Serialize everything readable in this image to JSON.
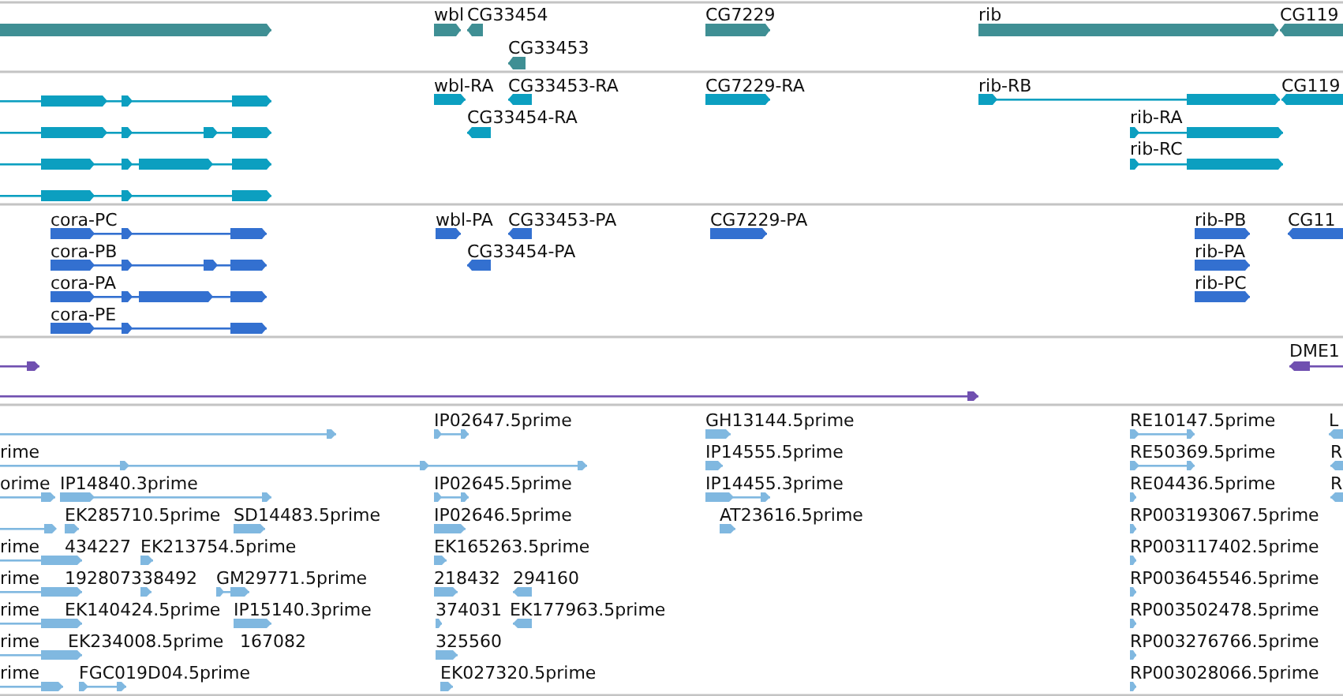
{
  "tracks": [
    {
      "kind": "gene",
      "color": "#3f8f94",
      "features": [
        {
          "reverse": false
        },
        {
          "label": "wbl",
          "reverse": false
        },
        {
          "label": "CG33454",
          "reverse": true
        },
        {
          "label": "CG33453",
          "reverse": true
        },
        {
          "label": "CG7229",
          "reverse": false
        },
        {
          "label": "rib",
          "reverse": false
        },
        {
          "label": "CG119",
          "reverse": true
        }
      ]
    },
    {
      "kind": "transcript",
      "color": "#0c9fc0",
      "features": [
        {
          "reverse": false
        },
        {
          "reverse": false
        },
        {
          "reverse": false
        },
        {
          "reverse": false
        },
        {
          "label": "wbl-RA",
          "reverse": false
        },
        {
          "label": "CG33453-RA",
          "reverse": true
        },
        {
          "label": "CG33454-RA",
          "reverse": true
        },
        {
          "label": "CG7229-RA",
          "reverse": false
        },
        {
          "label": "rib-RB",
          "reverse": false
        },
        {
          "label": "rib-RA",
          "reverse": false
        },
        {
          "label": "rib-RC",
          "reverse": false
        },
        {
          "label": "CG119",
          "reverse": true
        }
      ]
    },
    {
      "kind": "protein",
      "color": "#3370d0",
      "features": [
        {
          "label": "cora-PC",
          "reverse": false
        },
        {
          "label": "cora-PB",
          "reverse": false
        },
        {
          "label": "cora-PA",
          "reverse": false
        },
        {
          "label": "cora-PE",
          "reverse": false
        },
        {
          "label": "wbl-PA",
          "reverse": false
        },
        {
          "label": "CG33453-PA",
          "reverse": true
        },
        {
          "label": "CG33454-PA",
          "reverse": true
        },
        {
          "label": "CG7229-PA",
          "reverse": false
        },
        {
          "label": "rib-PB",
          "reverse": false
        },
        {
          "label": "rib-PA",
          "reverse": false
        },
        {
          "label": "rib-PC",
          "reverse": false
        },
        {
          "label": "CG11",
          "reverse": true
        }
      ]
    },
    {
      "kind": "match",
      "color": "#7050b0",
      "features": [
        {
          "reverse": false
        },
        {
          "label": "DME1",
          "reverse": true
        },
        {
          "reverse": false
        }
      ]
    },
    {
      "kind": "est",
      "color": "#80b8e0",
      "features": [
        {
          "reverse": false
        },
        {
          "label": "rime",
          "reverse": false
        },
        {
          "label": "orime",
          "reverse": false
        },
        {
          "label": "IP14840.3prime",
          "reverse": false
        },
        {
          "reverse": false
        },
        {
          "label": "EK285710.5prime",
          "reverse": false
        },
        {
          "label": "SD14483.5prime",
          "reverse": false
        },
        {
          "label": "rime",
          "reverse": false
        },
        {
          "label": "434227"
        },
        {
          "label": "EK213754.5prime",
          "reverse": false
        },
        {
          "label": "rime",
          "reverse": false
        },
        {
          "label": "192807338492",
          "reverse": false
        },
        {
          "label": "GM29771.5prime",
          "reverse": false
        },
        {
          "label": "rime",
          "reverse": false
        },
        {
          "label": "EK140424.5prime"
        },
        {
          "label": "IP15140.3prime",
          "reverse": false
        },
        {
          "label": "rime",
          "reverse": false
        },
        {
          "label": "EK234008.5prime"
        },
        {
          "label": "167082"
        },
        {
          "label": "rime",
          "reverse": false
        },
        {
          "label": "FGC019D04.5prime",
          "reverse": false
        },
        {
          "label": "IP02647.5prime",
          "reverse": false
        },
        {
          "label": "IP02645.5prime",
          "reverse": false
        },
        {
          "label": "IP02646.5prime",
          "reverse": false
        },
        {
          "label": "EK165263.5prime",
          "reverse": false
        },
        {
          "label": "218432",
          "reverse": false
        },
        {
          "label": "294160",
          "reverse": true
        },
        {
          "label": "374031",
          "reverse": false
        },
        {
          "label": "EK177963.5prime",
          "reverse": true
        },
        {
          "label": "325560",
          "reverse": false
        },
        {
          "label": "EK027320.5prime",
          "reverse": false
        },
        {
          "label": "GH13144.5prime",
          "reverse": false
        },
        {
          "label": "IP14555.5prime",
          "reverse": false
        },
        {
          "label": "IP14455.3prime",
          "reverse": false
        },
        {
          "label": "AT23616.5prime",
          "reverse": false
        },
        {
          "label": "RE10147.5prime",
          "reverse": false
        },
        {
          "label": "RE50369.5prime",
          "reverse": false
        },
        {
          "label": "RE04436.5prime",
          "reverse": false
        },
        {
          "label": "RP003193067.5prime",
          "reverse": false
        },
        {
          "label": "RP003117402.5prime",
          "reverse": false
        },
        {
          "label": "RP003645546.5prime",
          "reverse": false
        },
        {
          "label": "RP003502478.5prime",
          "reverse": false
        },
        {
          "label": "RP003276766.5prime",
          "reverse": false
        },
        {
          "label": "RP003028066.5prime",
          "reverse": false
        },
        {
          "label": "L",
          "reverse": true
        },
        {
          "label": "R",
          "reverse": true
        },
        {
          "label": "R",
          "reverse": true
        }
      ]
    }
  ]
}
